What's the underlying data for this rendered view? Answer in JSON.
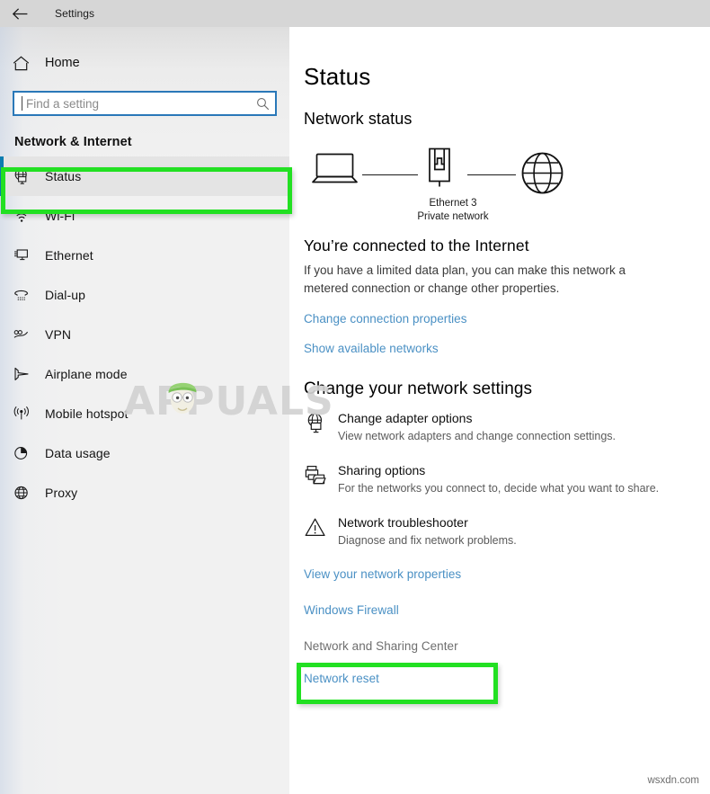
{
  "window": {
    "title": "Settings",
    "back_icon": "back-arrow-icon"
  },
  "sidebar": {
    "home": {
      "label": "Home",
      "icon": "home-icon"
    },
    "search": {
      "placeholder": "Find a setting",
      "value": "",
      "icon": "search-icon"
    },
    "section_title": "Network & Internet",
    "selected_item": "Status",
    "accent_color": "#0c7db0",
    "items": [
      {
        "label": "Status",
        "icon": "globe-monitor-icon",
        "selected": true
      },
      {
        "label": "Wi-Fi",
        "icon": "wifi-icon",
        "selected": false
      },
      {
        "label": "Ethernet",
        "icon": "ethernet-icon",
        "selected": false
      },
      {
        "label": "Dial-up",
        "icon": "dialup-phone-icon",
        "selected": false
      },
      {
        "label": "VPN",
        "icon": "vpn-icon",
        "selected": false
      },
      {
        "label": "Airplane mode",
        "icon": "airplane-icon",
        "selected": false
      },
      {
        "label": "Mobile hotspot",
        "icon": "hotspot-icon",
        "selected": false
      },
      {
        "label": "Data usage",
        "icon": "pie-chart-icon",
        "selected": false
      },
      {
        "label": "Proxy",
        "icon": "globe-icon",
        "selected": false
      }
    ]
  },
  "main": {
    "page_title": "Status",
    "network_status_heading": "Network status",
    "diagram": {
      "device_icon": "laptop-icon",
      "adapter_icon": "ethernet-port-icon",
      "internet_icon": "globe-icon",
      "adapter_name": "Ethernet 3",
      "network_type": "Private network"
    },
    "connected_heading": "You’re connected to the Internet",
    "connected_description": "If you have a limited data plan, you can make this network a metered connection or change other properties.",
    "top_links": [
      {
        "label": "Change connection properties",
        "state": "normal"
      },
      {
        "label": "Show available networks",
        "state": "normal"
      }
    ],
    "change_settings_heading": "Change your network settings",
    "options": [
      {
        "icon": "globe-monitor-icon",
        "title": "Change adapter options",
        "description": "View network adapters and change connection settings."
      },
      {
        "icon": "printer-folder-icon",
        "title": "Sharing options",
        "description": "For the networks you connect to, decide what you want to share."
      },
      {
        "icon": "warning-triangle-icon",
        "title": "Network troubleshooter",
        "description": "Diagnose and fix network problems."
      }
    ],
    "bottom_links": [
      {
        "label": "View your network properties",
        "state": "normal"
      },
      {
        "label": "Windows Firewall",
        "state": "normal"
      },
      {
        "label": "Network and Sharing Center",
        "state": "hovered"
      },
      {
        "label": "Network reset",
        "state": "normal"
      }
    ]
  },
  "annotations": {
    "highlight_color": "#22e022",
    "boxes": [
      {
        "target": "sidebar-item-status",
        "label": "Status"
      },
      {
        "target": "link-network-and-sharing-center",
        "label": "Network and Sharing Center"
      }
    ]
  },
  "watermark": {
    "brand": "APPUALS",
    "footer": "wsxdn.com"
  },
  "colors": {
    "link": "#4a90c4",
    "link_hovered": "#6e6e6e",
    "titlebar_bg": "#d6d6d6",
    "sidebar_bg": "#f1f1f1",
    "main_bg": "#ffffff",
    "selected_row_bg": "#e4e4e4"
  }
}
